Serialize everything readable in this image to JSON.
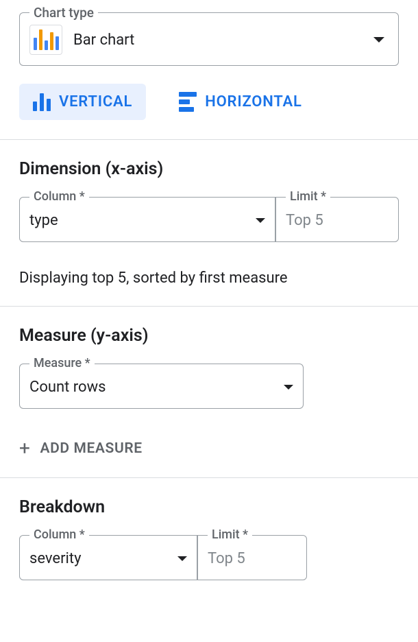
{
  "chartType": {
    "legend": "Chart type",
    "value": "Bar chart"
  },
  "tabs": {
    "vertical": "VERTICAL",
    "horizontal": "HORIZONTAL"
  },
  "dimension": {
    "title": "Dimension (x-axis)",
    "column_legend": "Column *",
    "column_value": "type",
    "limit_legend": "Limit *",
    "limit_value": "Top 5",
    "note": "Displaying top 5, sorted by first measure"
  },
  "measure": {
    "title": "Measure (y-axis)",
    "legend": "Measure *",
    "value": "Count rows",
    "add_label": "ADD MEASURE"
  },
  "breakdown": {
    "title": "Breakdown",
    "column_legend": "Column *",
    "column_value": "severity",
    "limit_legend": "Limit *",
    "limit_value": "Top 5"
  }
}
